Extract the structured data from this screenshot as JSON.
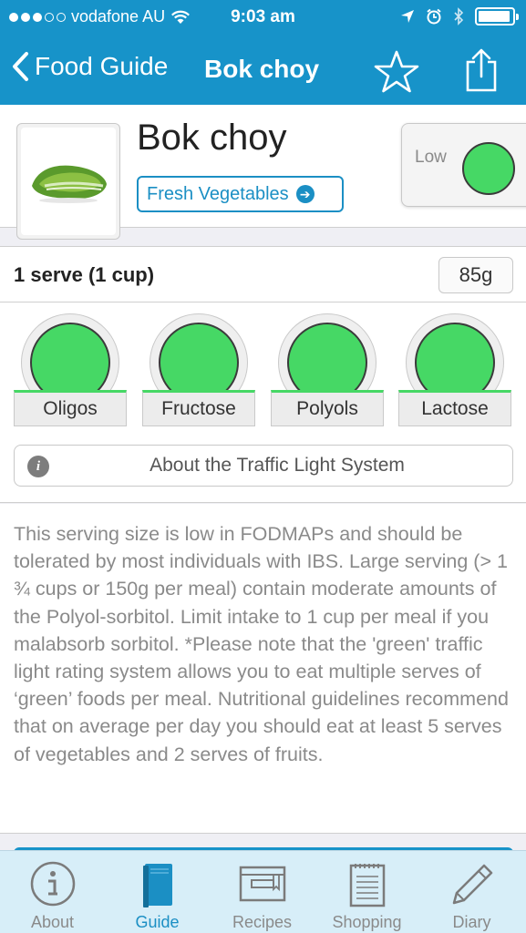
{
  "status": {
    "carrier": "vodafone AU",
    "time": "9:03 am"
  },
  "nav": {
    "back_label": "Food Guide",
    "title": "Bok choy"
  },
  "food": {
    "name": "Bok choy",
    "category": "Fresh Vegetables",
    "overall_rating_label": "Low",
    "overall_rating_color": "#46d865"
  },
  "serving": {
    "label": "1 serve (1 cup)",
    "weight": "85g"
  },
  "lights": [
    {
      "label": "Oligos",
      "color": "#46d865"
    },
    {
      "label": "Fructose",
      "color": "#46d865"
    },
    {
      "label": "Polyols",
      "color": "#46d865"
    },
    {
      "label": "Lactose",
      "color": "#46d865"
    }
  ],
  "about_button": "About the Traffic Light System",
  "description": "This serving size is low in FODMAPs and should be tolerated by most individuals with IBS.  Large serving (> 1 ¾ cups or 150g per meal) contain moderate amounts of the Polyol-sorbitol. Limit intake to 1 cup per meal if you malabsorb sorbitol. *Please note that the 'green' traffic light rating system allows you to eat multiple serves of ‘green’ foods per meal. Nutritional guidelines recommend that on average per day you should eat at least 5 serves of vegetables and 2 serves of fruits.",
  "tabs": [
    {
      "label": "About",
      "icon": "info-icon",
      "active": false
    },
    {
      "label": "Guide",
      "icon": "book-icon",
      "active": true
    },
    {
      "label": "Recipes",
      "icon": "recipe-box-icon",
      "active": false
    },
    {
      "label": "Shopping",
      "icon": "notepad-icon",
      "active": false
    },
    {
      "label": "Diary",
      "icon": "pencil-icon",
      "active": false
    }
  ],
  "colors": {
    "brand_blue": "#1793c9",
    "green": "#46d865",
    "tab_bar_bg": "#d7eef8"
  }
}
